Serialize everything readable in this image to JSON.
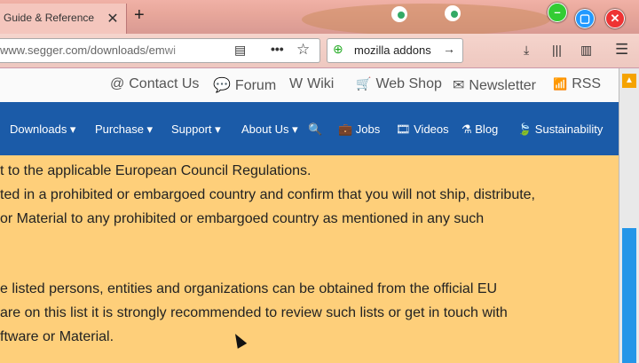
{
  "browser": {
    "tab_title": "Guide & Reference",
    "tab_close": "✕",
    "new_tab": "+",
    "url": "www.segger.com/downloads/emwi",
    "search_text": "mozilla addons",
    "search_arrow": "→",
    "icons": [
      "reader-icon",
      "more-icon",
      "bookmark-star-icon",
      "download-icon",
      "library-icon",
      "sidebar-icon",
      "menu-icon"
    ]
  },
  "topbar": {
    "items": [
      {
        "icon": "@",
        "label": "Contact Us"
      },
      {
        "icon": "💬",
        "label": "Forum"
      },
      {
        "icon": "W",
        "label": "Wiki"
      },
      {
        "icon": "🛒",
        "label": "Web Shop"
      },
      {
        "icon": "✉",
        "label": "Newsletter"
      },
      {
        "icon": "📶",
        "label": "RSS"
      }
    ]
  },
  "mainnav": {
    "items": [
      {
        "label": "Downloads ▾"
      },
      {
        "label": "Purchase ▾"
      },
      {
        "label": "Support ▾"
      },
      {
        "label": "About Us ▾"
      },
      {
        "label": "🔍"
      },
      {
        "label": "💼 Jobs"
      },
      {
        "label": "🎞 Videos"
      },
      {
        "label": "⚗ Blog"
      },
      {
        "label": "🍃 Sustainability"
      }
    ]
  },
  "content": {
    "lines": [
      "t to the applicable European Council Regulations.",
      "ted in a prohibited or embargoed country and confirm that you will not ship, distribute,",
      "or Material to any prohibited or embargoed country as mentioned in any such",
      "e listed persons, entities and organizations can be obtained from the official EU",
      "are on this list it is strongly recommended to review such lists or get in touch with",
      "ftware or Material."
    ]
  },
  "colors": {
    "nav_blue": "#1b5ba8",
    "content_bg": "#fecf7a",
    "scroll_thumb": "#2496e8",
    "scroll_up": "#f5a300"
  }
}
